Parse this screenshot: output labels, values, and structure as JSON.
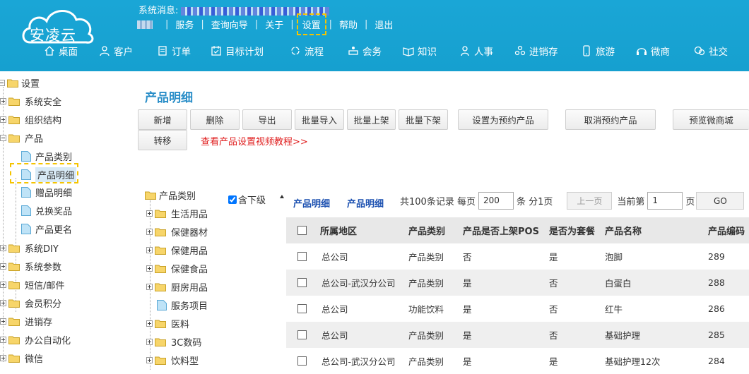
{
  "header": {
    "logo_text": "安凌云",
    "sysmsg_label": "系统消息:",
    "top_links": [
      "服务",
      "查询向导",
      "关于",
      "设置",
      "帮助",
      "退出"
    ],
    "highlighted_link": "设置",
    "nav": [
      {
        "label": "桌面",
        "icon": "home-icon"
      },
      {
        "label": "客户",
        "icon": "customer-icon"
      },
      {
        "label": "订单",
        "icon": "order-icon"
      },
      {
        "label": "目标计划",
        "icon": "target-plan-icon"
      },
      {
        "label": "流程",
        "icon": "process-icon"
      },
      {
        "label": "会务",
        "icon": "meeting-icon"
      },
      {
        "label": "知识",
        "icon": "knowledge-icon"
      },
      {
        "label": "人事",
        "icon": "hr-icon"
      },
      {
        "label": "进销存",
        "icon": "inventory-icon"
      },
      {
        "label": "旅游",
        "icon": "travel-icon"
      },
      {
        "label": "微商",
        "icon": "wechat-shop-icon"
      },
      {
        "label": "社交",
        "icon": "social-icon"
      }
    ]
  },
  "left_tree": {
    "root": "设置",
    "items": [
      {
        "label": "系统安全",
        "type": "folder",
        "expanded": false
      },
      {
        "label": "组织结构",
        "type": "folder",
        "expanded": false
      },
      {
        "label": "产品",
        "type": "folder",
        "expanded": true
      },
      {
        "label": "产品类别",
        "type": "doc"
      },
      {
        "label": "产品明细",
        "type": "doc",
        "selected": true
      },
      {
        "label": "赠品明细",
        "type": "doc"
      },
      {
        "label": "兑换奖品",
        "type": "doc"
      },
      {
        "label": "产品更名",
        "type": "doc"
      },
      {
        "label": "系统DIY",
        "type": "folder",
        "expanded": false
      },
      {
        "label": "系统参数",
        "type": "folder",
        "expanded": false
      },
      {
        "label": "短信/邮件",
        "type": "folder",
        "expanded": false
      },
      {
        "label": "会员积分",
        "type": "folder",
        "expanded": false
      },
      {
        "label": "进销存",
        "type": "folder",
        "expanded": false
      },
      {
        "label": "办公自动化",
        "type": "folder",
        "expanded": false
      },
      {
        "label": "微信",
        "type": "folder",
        "expanded": false
      }
    ]
  },
  "page": {
    "title": "产品明细",
    "buttons": [
      "新增",
      "删除",
      "导出",
      "批量导入",
      "批量上架",
      "批量下架",
      "设置为预约产品",
      "取消预约产品",
      "预览微商城",
      "转移"
    ],
    "tutorial_link": "查看产品设置视频教程>>"
  },
  "category_tree": {
    "root": "产品类别",
    "include_sub_label": "含下级",
    "include_sub_checked": true,
    "items": [
      {
        "label": "生活用品",
        "type": "folder"
      },
      {
        "label": "保健器材",
        "type": "folder"
      },
      {
        "label": "保健用品",
        "type": "folder"
      },
      {
        "label": "保健食品",
        "type": "folder"
      },
      {
        "label": "厨房用品",
        "type": "folder"
      },
      {
        "label": "服务项目",
        "type": "doc"
      },
      {
        "label": "医料",
        "type": "folder"
      },
      {
        "label": "3C数码",
        "type": "folder"
      },
      {
        "label": "饮料型",
        "type": "folder"
      }
    ]
  },
  "list": {
    "crumbs": [
      "产品明细",
      "产品明细"
    ],
    "pager": {
      "total_text": "共100条记录 每页",
      "per_page": "200",
      "per_page_suffix": "条 分1页",
      "prev_label": "上一页",
      "current_label": "当前第",
      "current_page": "1",
      "page_suffix": "页",
      "go_label": "GO"
    },
    "columns": [
      "所属地区",
      "产品类别",
      "产品是否上架POS",
      "是否为套餐",
      "产品名称",
      "产品编码"
    ],
    "rows": [
      [
        "总公司",
        "产品类别",
        "否",
        "是",
        "泡脚",
        "289"
      ],
      [
        "总公司-武汉分公司",
        "产品类别",
        "是",
        "否",
        "白蛋白",
        "288"
      ],
      [
        "总公司",
        "功能饮料",
        "是",
        "否",
        "红牛",
        "286"
      ],
      [
        "总公司",
        "产品类别",
        "是",
        "否",
        "基础护理",
        "285"
      ],
      [
        "总公司-武汉分公司",
        "产品类别",
        "是",
        "是",
        "基础护理12次",
        "284"
      ]
    ]
  }
}
